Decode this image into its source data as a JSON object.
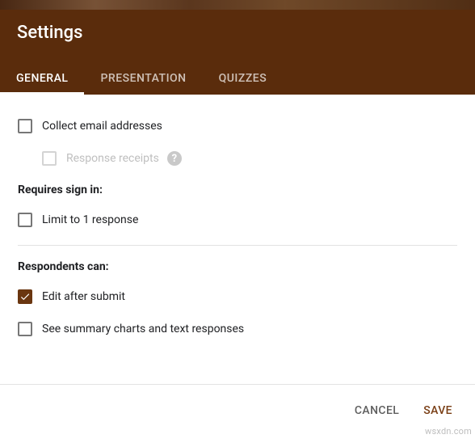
{
  "header": {
    "title": "Settings"
  },
  "tabs": [
    {
      "label": "GENERAL",
      "active": true
    },
    {
      "label": "PRESENTATION",
      "active": false
    },
    {
      "label": "QUIZZES",
      "active": false
    }
  ],
  "options": {
    "collect_email": {
      "label": "Collect email addresses",
      "checked": false
    },
    "response_receipts": {
      "label": "Response receipts",
      "checked": false,
      "disabled": true
    }
  },
  "section_signin": "Requires sign in:",
  "signin": {
    "limit1": {
      "label": "Limit to 1 response",
      "checked": false
    }
  },
  "section_respondents": "Respondents can:",
  "respondents": {
    "edit_after_submit": {
      "label": "Edit after submit",
      "checked": true
    },
    "see_summary": {
      "label": "See summary charts and text responses",
      "checked": false
    }
  },
  "footer": {
    "cancel": "CANCEL",
    "save": "SAVE"
  },
  "watermark": "wsxdn.com"
}
